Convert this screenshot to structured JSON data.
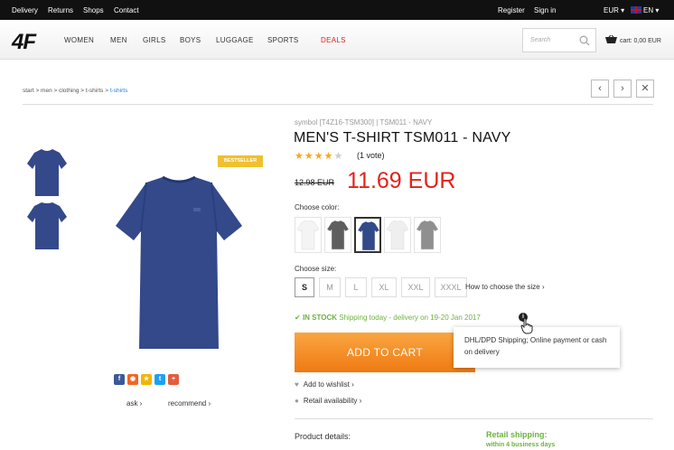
{
  "topbar": {
    "links": [
      "Delivery",
      "Returns",
      "Shops",
      "Contact"
    ],
    "register": "Register",
    "signin": "Sign in",
    "currency": "EUR ▾",
    "language": "EN ▾"
  },
  "header": {
    "logo": "4F",
    "nav": [
      "WOMEN",
      "MEN",
      "GIRLS",
      "BOYS",
      "LUGGAGE",
      "SPORTS",
      "DEALS"
    ],
    "search_placeholder": "Search",
    "cart": "cart: 0,00 EUR"
  },
  "breadcrumb": {
    "path": "start > men > clothing > t-shirts > ",
    "active": "t-shirts"
  },
  "nav_buttons": {
    "prev": "‹",
    "next": "›",
    "close": "✕"
  },
  "gallery": {
    "bestseller": "BESTSELLER",
    "social": [
      {
        "icon": "facebook-icon",
        "glyph": "f",
        "color": "#3b5998"
      },
      {
        "icon": "rss-icon",
        "glyph": "◉",
        "color": "#f26522"
      },
      {
        "icon": "star-icon",
        "glyph": "★",
        "color": "#f5b400"
      },
      {
        "icon": "twitter-icon",
        "glyph": "t",
        "color": "#1da1f2"
      },
      {
        "icon": "plus-icon",
        "glyph": "+",
        "color": "#e45d3c"
      }
    ],
    "ask": "ask",
    "recommend": "recommend"
  },
  "product": {
    "symbol": "symbol [T4Z16-TSM300] | TSM011 - NAVY",
    "title": "MEN'S T-SHIRT TSM011 - NAVY",
    "rating": 4,
    "rating_max": 5,
    "votes": "(1 vote)",
    "old_price": "12.98 EUR",
    "price": "11.69 EUR",
    "color_label": "Choose color:",
    "colors": [
      {
        "hex": "#f4f4f4"
      },
      {
        "hex": "#5e5e5e"
      },
      {
        "hex": "#324a8a"
      },
      {
        "hex": "#efefef"
      },
      {
        "hex": "#8f8f8f"
      }
    ],
    "size_label": "Choose size:",
    "sizes": [
      "S",
      "M",
      "L",
      "XL",
      "XXL",
      "XXXL"
    ],
    "size_guide": "How to choose the size",
    "stock_status": "IN STOCK",
    "stock_detail": "Shipping today - delivery on 19-20 Jan 2017",
    "add_to_cart": "ADD TO CART",
    "tooltip": "DHL/DPD Shipping; Online payment or cash on delivery",
    "wishlist": "Add to wishlist",
    "retail_availability": "Retail availability",
    "details": "Product details:",
    "retail_shipping": "Retail shipping:",
    "retail_time": "within 4 business days"
  },
  "colors": {
    "accent": "#e2231a",
    "button": "#f39c2b",
    "stock": "#6cb33f",
    "link": "#1a7fd0"
  }
}
